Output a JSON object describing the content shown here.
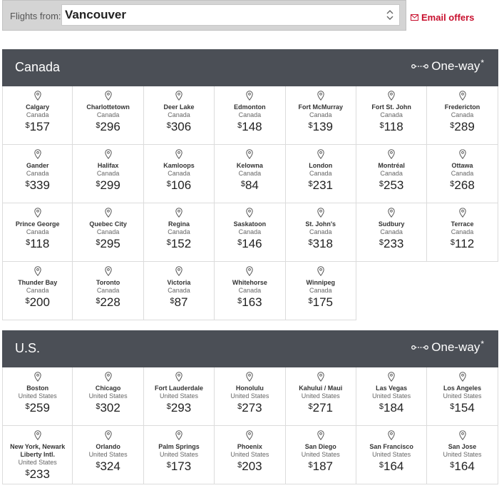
{
  "header": {
    "flights_from_label": "Flights from:",
    "origin_value": "Vancouver",
    "email_offers_label": "Email offers"
  },
  "colors": {
    "header_bg": "#4b4f56",
    "accent": "#c8102e"
  },
  "sections": [
    {
      "title": "Canada",
      "trip_type": "One-way",
      "asterisk": "*",
      "destinations": [
        {
          "city": "Calgary",
          "country": "Canada",
          "currency": "$",
          "price": "157"
        },
        {
          "city": "Charlottetown",
          "country": "Canada",
          "currency": "$",
          "price": "296"
        },
        {
          "city": "Deer Lake",
          "country": "Canada",
          "currency": "$",
          "price": "306"
        },
        {
          "city": "Edmonton",
          "country": "Canada",
          "currency": "$",
          "price": "148"
        },
        {
          "city": "Fort McMurray",
          "country": "Canada",
          "currency": "$",
          "price": "139"
        },
        {
          "city": "Fort St. John",
          "country": "Canada",
          "currency": "$",
          "price": "118"
        },
        {
          "city": "Fredericton",
          "country": "Canada",
          "currency": "$",
          "price": "289"
        },
        {
          "city": "Gander",
          "country": "Canada",
          "currency": "$",
          "price": "339"
        },
        {
          "city": "Halifax",
          "country": "Canada",
          "currency": "$",
          "price": "299"
        },
        {
          "city": "Kamloops",
          "country": "Canada",
          "currency": "$",
          "price": "106"
        },
        {
          "city": "Kelowna",
          "country": "Canada",
          "currency": "$",
          "price": "84"
        },
        {
          "city": "London",
          "country": "Canada",
          "currency": "$",
          "price": "231"
        },
        {
          "city": "Montréal",
          "country": "Canada",
          "currency": "$",
          "price": "253"
        },
        {
          "city": "Ottawa",
          "country": "Canada",
          "currency": "$",
          "price": "268"
        },
        {
          "city": "Prince George",
          "country": "Canada",
          "currency": "$",
          "price": "118"
        },
        {
          "city": "Quebec City",
          "country": "Canada",
          "currency": "$",
          "price": "295"
        },
        {
          "city": "Regina",
          "country": "Canada",
          "currency": "$",
          "price": "152"
        },
        {
          "city": "Saskatoon",
          "country": "Canada",
          "currency": "$",
          "price": "146"
        },
        {
          "city": "St. John's",
          "country": "Canada",
          "currency": "$",
          "price": "318"
        },
        {
          "city": "Sudbury",
          "country": "Canada",
          "currency": "$",
          "price": "233"
        },
        {
          "city": "Terrace",
          "country": "Canada",
          "currency": "$",
          "price": "112"
        },
        {
          "city": "Thunder Bay",
          "country": "Canada",
          "currency": "$",
          "price": "200"
        },
        {
          "city": "Toronto",
          "country": "Canada",
          "currency": "$",
          "price": "228"
        },
        {
          "city": "Victoria",
          "country": "Canada",
          "currency": "$",
          "price": "87"
        },
        {
          "city": "Whitehorse",
          "country": "Canada",
          "currency": "$",
          "price": "163"
        },
        {
          "city": "Winnipeg",
          "country": "Canada",
          "currency": "$",
          "price": "175"
        }
      ]
    },
    {
      "title": "U.S.",
      "trip_type": "One-way",
      "asterisk": "*",
      "destinations": [
        {
          "city": "Boston",
          "country": "United States",
          "currency": "$",
          "price": "259"
        },
        {
          "city": "Chicago",
          "country": "United States",
          "currency": "$",
          "price": "302"
        },
        {
          "city": "Fort Lauderdale",
          "country": "United States",
          "currency": "$",
          "price": "293"
        },
        {
          "city": "Honolulu",
          "country": "United States",
          "currency": "$",
          "price": "273"
        },
        {
          "city": "Kahului / Maui",
          "country": "United States",
          "currency": "$",
          "price": "271"
        },
        {
          "city": "Las Vegas",
          "country": "United States",
          "currency": "$",
          "price": "184"
        },
        {
          "city": "Los Angeles",
          "country": "United States",
          "currency": "$",
          "price": "154"
        },
        {
          "city": "New York, Newark Liberty Intl.",
          "country": "United States",
          "currency": "$",
          "price": "233"
        },
        {
          "city": "Orlando",
          "country": "United States",
          "currency": "$",
          "price": "324"
        },
        {
          "city": "Palm Springs",
          "country": "United States",
          "currency": "$",
          "price": "173"
        },
        {
          "city": "Phoenix",
          "country": "United States",
          "currency": "$",
          "price": "203"
        },
        {
          "city": "San Diego",
          "country": "United States",
          "currency": "$",
          "price": "187"
        },
        {
          "city": "San Francisco",
          "country": "United States",
          "currency": "$",
          "price": "164"
        },
        {
          "city": "San Jose",
          "country": "United States",
          "currency": "$",
          "price": "164"
        }
      ]
    }
  ]
}
